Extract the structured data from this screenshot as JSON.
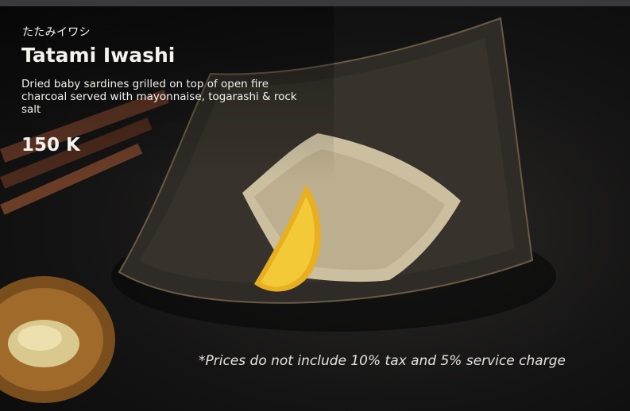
{
  "item": {
    "subtitle_jp": "たたみイワシ",
    "title": "Tatami Iwashi",
    "description": "Dried baby sardines grilled on top of open fire charcoal served with mayonnaise, togarashi & rock salt",
    "price": "150 K"
  },
  "footer": {
    "disclaimer": "*Prices do not include 10% tax and 5% service charge"
  }
}
